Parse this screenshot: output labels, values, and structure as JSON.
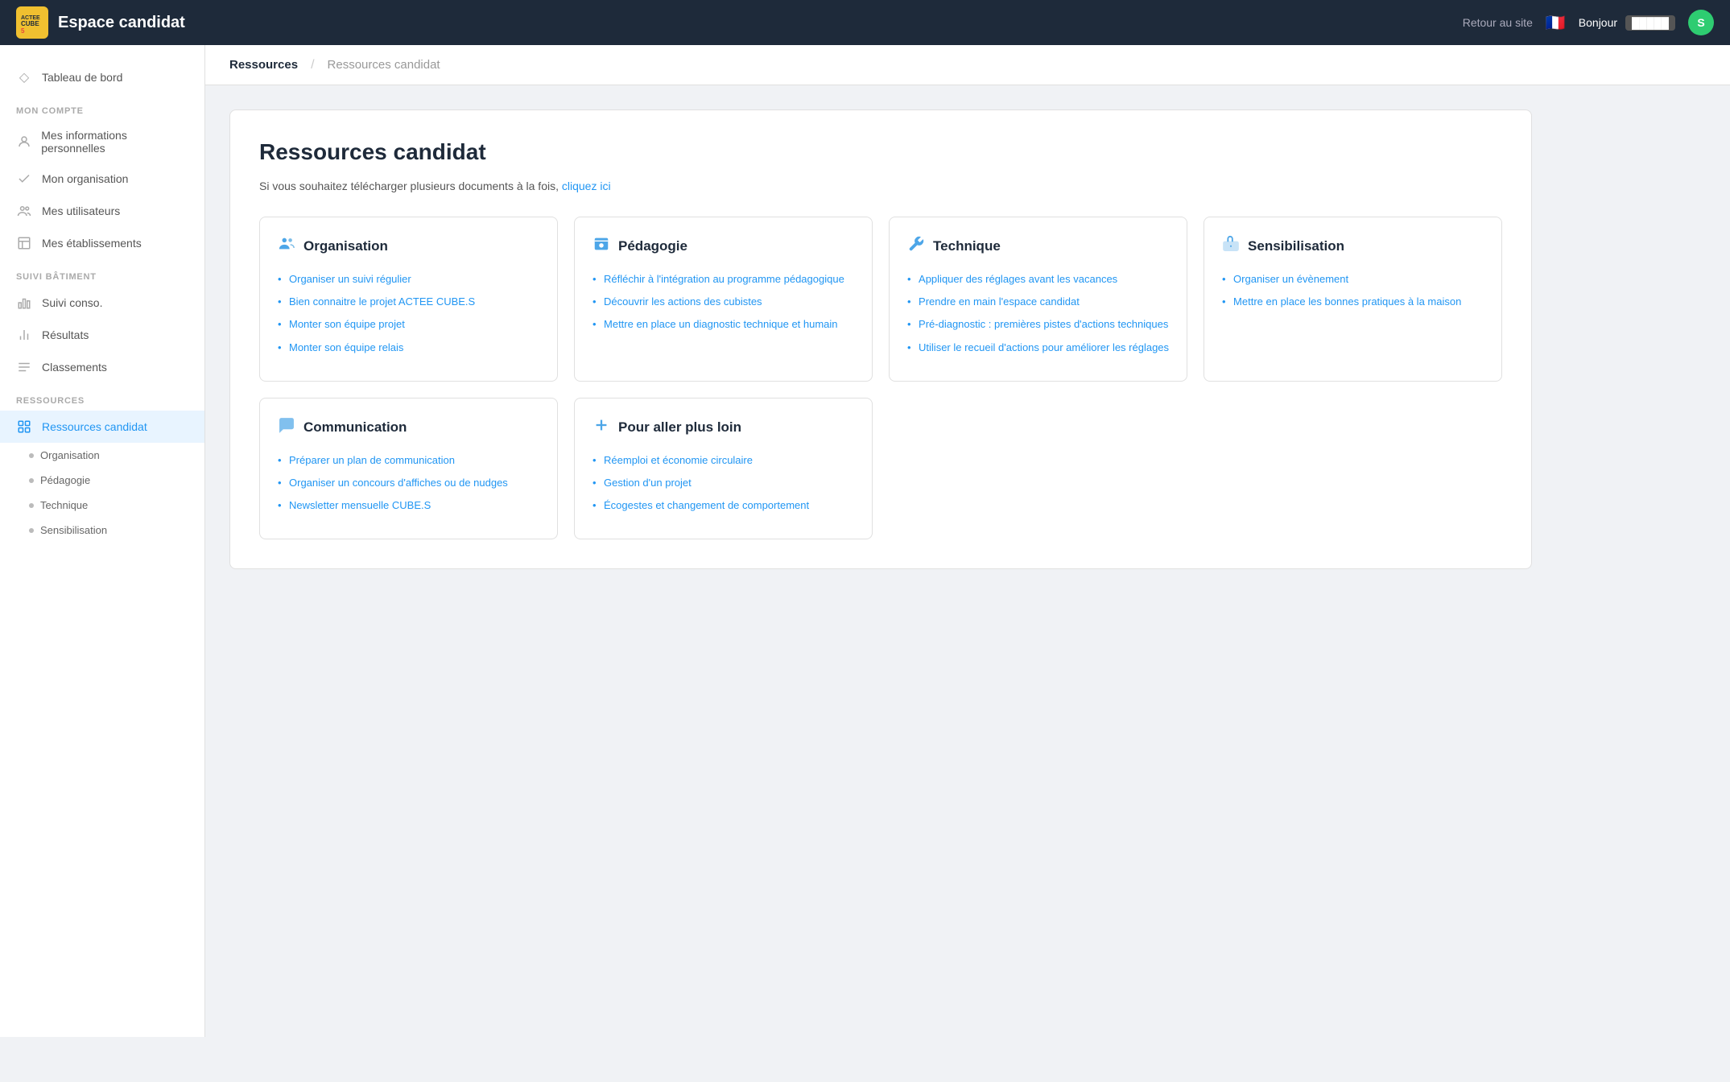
{
  "header": {
    "logo_alt": "ACTEE CUBE 5",
    "logo_letter": "S",
    "title": "Espace candidat",
    "nav_link": "Retour au site",
    "bonjour": "Bonjour",
    "avatar_letter": "S"
  },
  "breadcrumb": {
    "item1": "Ressources",
    "item2": "Ressources candidat"
  },
  "sidebar": {
    "dashboard_label": "Tableau de bord",
    "section_mon_compte": "MON COMPTE",
    "mes_infos": "Mes informations personnelles",
    "mon_organisation": "Mon organisation",
    "mes_utilisateurs": "Mes utilisateurs",
    "mes_etablissements": "Mes établissements",
    "section_suivi": "SUIVI BÂTIMENT",
    "suivi_conso": "Suivi conso.",
    "resultats": "Résultats",
    "classements": "Classements",
    "section_ressources": "RESSOURCES",
    "ressources_candidat": "Ressources candidat",
    "sub_organisation": "Organisation",
    "sub_pedagogie": "Pédagogie",
    "sub_technique": "Technique",
    "sub_sensibilisation": "Sensibilisation"
  },
  "main": {
    "title": "Ressources candidat",
    "subtitle_text": "Si vous souhaitez télécharger plusieurs documents à la fois,",
    "subtitle_link": "cliquez ici",
    "cards": [
      {
        "id": "organisation",
        "icon": "👥",
        "title": "Organisation",
        "color": "#4da6e8",
        "items": [
          "Organiser un suivi régulier",
          "Bien connaitre le projet ACTEE CUBE.S",
          "Monter son équipe projet",
          "Monter son équipe relais"
        ]
      },
      {
        "id": "pedagogie",
        "icon": "🏫",
        "title": "Pédagogie",
        "color": "#4da6e8",
        "items": [
          "Réfléchir à l'intégration au programme pédagogique",
          "Découvrir les actions des cubistes",
          "Mettre en place un diagnostic technique et humain"
        ]
      },
      {
        "id": "technique",
        "icon": "🔧",
        "title": "Technique",
        "color": "#4da6e8",
        "items": [
          "Appliquer des réglages avant les vacances",
          "Prendre en main l'espace candidat",
          "Pré-diagnostic : premières pistes d'actions techniques",
          "Utiliser le recueil d'actions pour améliorer les réglages"
        ]
      },
      {
        "id": "sensibilisation",
        "icon": "👍",
        "title": "Sensibilisation",
        "color": "#4da6e8",
        "items": [
          "Organiser un évènement",
          "Mettre en place les bonnes pratiques à la maison"
        ]
      }
    ],
    "cards_row2": [
      {
        "id": "communication",
        "icon": "💬",
        "title": "Communication",
        "color": "#4da6e8",
        "items": [
          "Préparer un plan de communication",
          "Organiser un concours d'affiches ou de nudges",
          "Newsletter mensuelle CUBE.S"
        ]
      },
      {
        "id": "pour-aller-plus-loin",
        "icon": "➕",
        "title": "Pour aller plus loin",
        "color": "#4da6e8",
        "items": [
          "Réemploi et économie circulaire",
          "Gestion d'un projet",
          "Écogestes et changement de comportement"
        ]
      }
    ]
  }
}
